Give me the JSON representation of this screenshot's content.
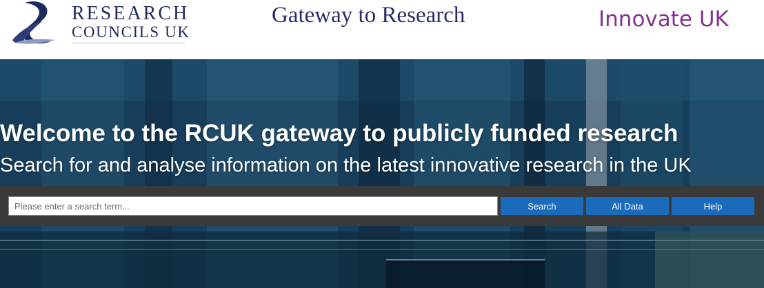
{
  "header": {
    "rcuk_logo": {
      "line1": "RESEARCH",
      "line2": "COUNCILS UK"
    },
    "site_title": "Gateway to Research",
    "innovate_logo": "Innovate UK"
  },
  "hero": {
    "heading": "Welcome to the RCUK gateway to publicly funded research",
    "subheading": "Search for and analyse information on the latest innovative research in the UK"
  },
  "search": {
    "placeholder": "Please enter a search term...",
    "value": "",
    "search_label": "Search",
    "all_data_label": "All Data",
    "help_label": "Help"
  },
  "colors": {
    "rcuk_navy": "#1f2a5c",
    "title_navy": "#2b2b6b",
    "innovate_purple": "#83338f",
    "button_blue": "#1b6bbd",
    "search_bar_bg": "#3a3a3a"
  },
  "icons": {
    "rcuk_mark": "rcuk-swoosh-logo"
  }
}
